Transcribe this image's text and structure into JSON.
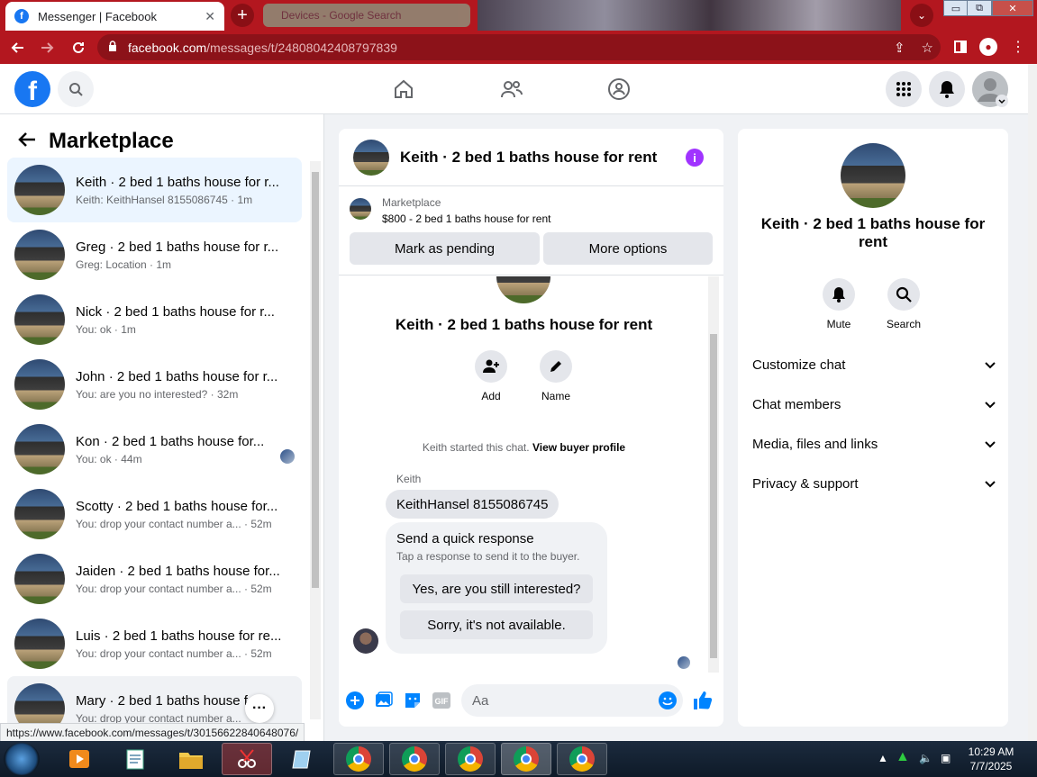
{
  "browser": {
    "tab_title": "Messenger | Facebook",
    "tab_close": "✕",
    "new_tab": "+",
    "ghost_tab_title": "Devices - Google Search",
    "url_host": "facebook.com",
    "url_path": "/messages/t/24808042408797839",
    "win_min": "▭",
    "win_restore": "⧉",
    "win_close": "✕"
  },
  "left": {
    "title": "Marketplace",
    "conversations": [
      {
        "name": "Keith · 2 bed 1 baths house for r...",
        "snippet": "Keith: KeithHansel 8155086745 · 1m"
      },
      {
        "name": "Greg · 2 bed 1 baths house for r...",
        "snippet": "Greg: Location · 1m"
      },
      {
        "name": "Nick · 2 bed 1 baths house for r...",
        "snippet": "You: ok · 1m"
      },
      {
        "name": "John · 2 bed 1 baths house for r...",
        "snippet": "You: are you no interested? · 32m"
      },
      {
        "name": "Kon · 2 bed 1 baths house for...",
        "snippet": "You: ok · 44m"
      },
      {
        "name": "Scotty · 2 bed 1 baths house for...",
        "snippet": "You: drop your contact number a... · 52m"
      },
      {
        "name": "Jaiden · 2 bed 1 baths house for...",
        "snippet": "You: drop your contact number a... · 52m"
      },
      {
        "name": "Luis · 2 bed 1 baths house for re...",
        "snippet": "You: drop your contact number a... · 52m"
      },
      {
        "name": "Mary · 2 bed 1 baths house f...",
        "snippet": "You: drop your contact number a..."
      }
    ],
    "more": "···"
  },
  "chat": {
    "title": "Keith · 2 bed 1 baths house for rent",
    "marketplace_label": "Marketplace",
    "listing": "$800 - 2 bed 1 baths house for rent",
    "mark_pending": "Mark as pending",
    "more_options": "More options",
    "profile_name": "Keith · 2 bed 1 baths house for rent",
    "add_label": "Add",
    "name_label": "Name",
    "started_text": "Keith started this chat.",
    "view_profile": "View buyer profile",
    "sender": "Keith",
    "message": "KeithHansel 8155086745",
    "quick_title": "Send a quick response",
    "quick_sub": "Tap a response to send it to the buyer.",
    "quick_1": "Yes, are you still interested?",
    "quick_2": "Sorry, it's not available.",
    "input_placeholder": "Aa"
  },
  "right": {
    "name": "Keith · 2 bed 1 baths house for rent",
    "mute": "Mute",
    "search": "Search",
    "menu": [
      "Customize chat",
      "Chat members",
      "Media, files and links",
      "Privacy & support"
    ]
  },
  "status_url": "https://www.facebook.com/messages/t/30156622840648076/",
  "taskbar": {
    "time": "10:29 AM",
    "date": "7/7/2025"
  },
  "colors": {
    "chrome_red": "#b3171f",
    "fb_blue": "#1877f2",
    "messenger_purple": "#a033ff",
    "active_conv": "#ebf5ff"
  }
}
